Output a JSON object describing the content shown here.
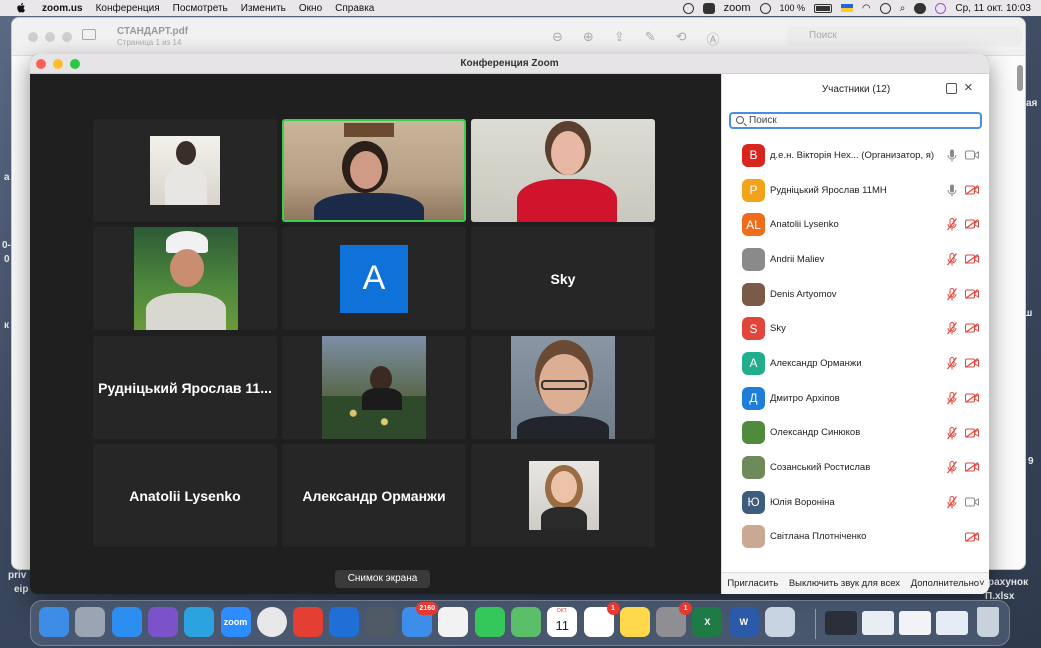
{
  "menubar": {
    "app": "zoom.us",
    "items": [
      "Конференция",
      "Посмотреть",
      "Изменить",
      "Окно",
      "Справка"
    ],
    "zoom_label": "zoom",
    "battery": "100 %",
    "clock": "Ср, 11 окт.  10:03"
  },
  "preview": {
    "title": "СТАНДАРТ.pdf",
    "subtitle": "Страница 1 из 14",
    "search_placeholder": "Поиск"
  },
  "background_fragments": [
    "ая",
    "а",
    "0-",
    "0",
    "к",
    "ш",
    "9",
    "priv",
    "eip",
    "рахунок",
    "П.xlsx"
  ],
  "zoom": {
    "window_title": "Конференция Zoom",
    "gallery": [
      {
        "type": "photo"
      },
      {
        "type": "photo"
      },
      {
        "type": "photo"
      },
      {
        "type": "photo"
      },
      {
        "type": "letter",
        "letter": "A"
      },
      {
        "type": "name",
        "name": "Sky"
      },
      {
        "type": "name",
        "name": "Рудніцький Ярослав 11..."
      },
      {
        "type": "photo"
      },
      {
        "type": "photo"
      },
      {
        "type": "name",
        "name": "Anatolii Lysenko"
      },
      {
        "type": "name",
        "name": "Александр Орманжи"
      },
      {
        "type": "photo"
      }
    ],
    "participants": {
      "title": "Участники (12)",
      "search_placeholder": "Поиск",
      "list": [
        {
          "initials": "В",
          "color": "#d9261c",
          "name": "д.е.н. Вікторія Нех...  (Организатор, я)",
          "mic": "on",
          "cam": "on"
        },
        {
          "initials": "Р",
          "color": "#f2a21b",
          "name": "Рудніцький Ярослав 11МН",
          "mic": "on",
          "cam": "off"
        },
        {
          "initials": "AL",
          "color": "#ef6c1a",
          "name": "Anatolii Lysenko",
          "mic": "off",
          "cam": "off"
        },
        {
          "initials": "",
          "color": "#8a8a8a",
          "name": "Andrii Maliev",
          "mic": "off",
          "cam": "off"
        },
        {
          "initials": "",
          "color": "#7a5a48",
          "name": "Denis Artyomov",
          "mic": "off",
          "cam": "off"
        },
        {
          "initials": "S",
          "color": "#e0463c",
          "name": "Sky",
          "mic": "off",
          "cam": "off"
        },
        {
          "initials": "А",
          "color": "#22ad8c",
          "name": "Александр Орманжи",
          "mic": "off",
          "cam": "off"
        },
        {
          "initials": "Д",
          "color": "#1f7fd8",
          "name": "Дмитро Архіпов",
          "mic": "off",
          "cam": "off"
        },
        {
          "initials": "",
          "color": "#4f8a3d",
          "name": "Олександр Синюков",
          "mic": "off",
          "cam": "off"
        },
        {
          "initials": "",
          "color": "#6f8a5a",
          "name": "Созанський Ростислав",
          "mic": "off",
          "cam": "off"
        },
        {
          "initials": "Ю",
          "color": "#3e5c7e",
          "name": "Юлія Вороніна",
          "mic": "off",
          "cam": "on"
        },
        {
          "initials": "",
          "color": "#c9a993",
          "name": "Світлана Плотніченко",
          "mic": "none",
          "cam": "off"
        }
      ],
      "footer": {
        "invite": "Пригласить",
        "mute_all": "Выключить звук для всех",
        "more": "Дополнительно"
      }
    }
  },
  "tooltip": "Снимок экрана",
  "dock": {
    "apps": [
      {
        "name": "finder",
        "color": "#3d8de6",
        "label": ""
      },
      {
        "name": "launchpad",
        "color": "#9aa4b2",
        "label": ""
      },
      {
        "name": "safari",
        "color": "#2b8ef0",
        "label": ""
      },
      {
        "name": "viber",
        "color": "#7b52c8",
        "label": ""
      },
      {
        "name": "telegram",
        "color": "#2aa3df",
        "label": ""
      },
      {
        "name": "zoom",
        "color": "#2d8cff",
        "label": "zoom"
      },
      {
        "name": "chrome",
        "color": "#e8e8e8",
        "label": ""
      },
      {
        "name": "anydesk",
        "color": "#e53f34",
        "label": ""
      },
      {
        "name": "teamviewer",
        "color": "#1f6fd6",
        "label": ""
      },
      {
        "name": "screenshot",
        "color": "#505a66",
        "label": ""
      },
      {
        "name": "mail",
        "color": "#3d8ee8",
        "label": "",
        "badge": "2160"
      },
      {
        "name": "preview",
        "color": "#f2f2f2",
        "label": ""
      },
      {
        "name": "messages",
        "color": "#34c759",
        "label": ""
      },
      {
        "name": "maps",
        "color": "#5bbf6a",
        "label": ""
      },
      {
        "name": "calendar",
        "color": "#ffffff",
        "label": "11",
        "top": "ОКТ."
      },
      {
        "name": "reminders",
        "color": "#ffffff",
        "label": "",
        "badge": "1"
      },
      {
        "name": "notes",
        "color": "#ffd84c",
        "label": ""
      },
      {
        "name": "settings",
        "color": "#8e8e93",
        "label": "",
        "badge": "1"
      },
      {
        "name": "excel",
        "color": "#1e7b45",
        "label": "X"
      },
      {
        "name": "word",
        "color": "#2b5aa8",
        "label": "W"
      },
      {
        "name": "photo-app",
        "color": "#c8d4e2",
        "label": ""
      }
    ],
    "recent": [
      {
        "name": "recent-window-1",
        "color": "#2a2f3a"
      },
      {
        "name": "recent-window-2",
        "color": "#e9eef4"
      },
      {
        "name": "recent-window-3",
        "color": "#f1f3f6"
      },
      {
        "name": "recent-window-4",
        "color": "#e6ecf3"
      }
    ],
    "trash": {
      "name": "trash",
      "color": "#c9d2dc"
    }
  }
}
